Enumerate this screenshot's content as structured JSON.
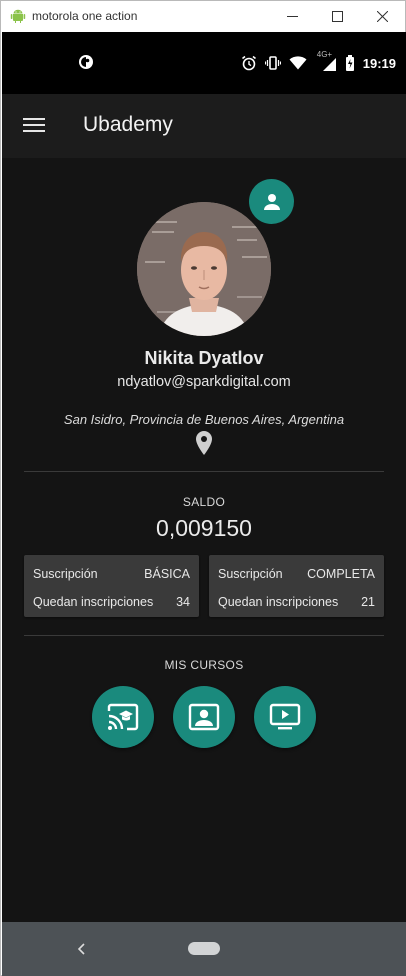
{
  "window": {
    "title": "motorola one action",
    "icon": "android-icon",
    "controls": [
      "minimize-icon",
      "maximize-icon",
      "close-icon"
    ]
  },
  "status_bar": {
    "network_label": "4G+",
    "time": "19:19"
  },
  "app_bar": {
    "title": "Ubademy"
  },
  "profile": {
    "name": "Nikita Dyatlov",
    "email": "ndyatlov@sparkdigital.com",
    "location": "San Isidro, Provincia de Buenos Aires, Argentina"
  },
  "balance": {
    "label": "SALDO",
    "value": "0,009150"
  },
  "subscriptions": [
    {
      "label": "Suscripción",
      "type": "BÁSICA",
      "remaining_label": "Quedan inscripciones",
      "remaining": "34"
    },
    {
      "label": "Suscripción",
      "type": "COMPLETA",
      "remaining_label": "Quedan inscripciones",
      "remaining": "21"
    }
  ],
  "courses": {
    "label": "MIS CURSOS",
    "buttons": [
      "cast-education-icon",
      "student-screen-icon",
      "video-course-icon"
    ]
  },
  "colors": {
    "accent": "#1a8a7d",
    "background": "#141414",
    "app_bar": "#1c1c1c",
    "card": "#3a3a3a",
    "nav_bar": "#4d5256"
  }
}
